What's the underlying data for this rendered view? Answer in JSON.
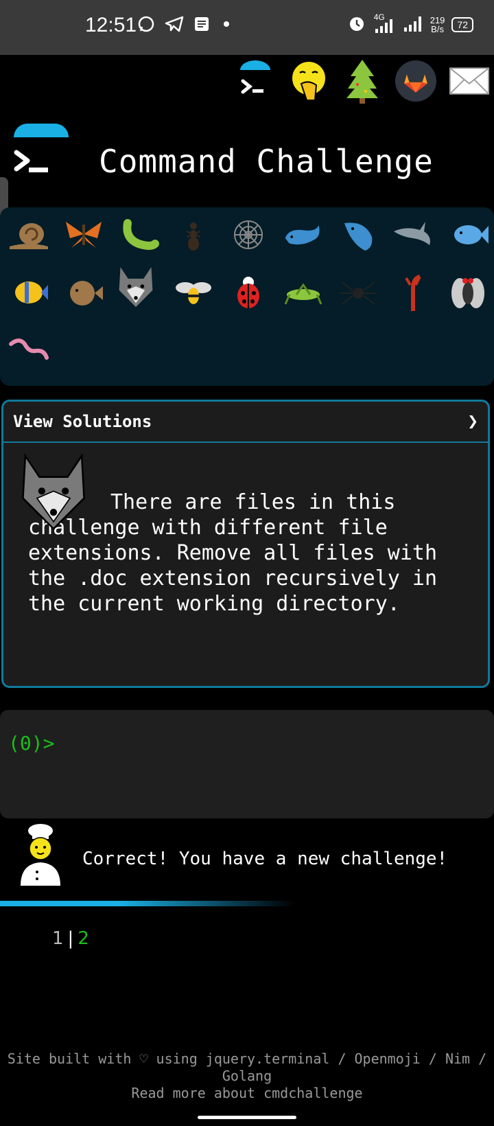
{
  "status_bar": {
    "time": "12:51",
    "network": "4G",
    "speed_value": "219",
    "speed_unit": "B/s",
    "battery": "72"
  },
  "header": {
    "title": "Command Challenge"
  },
  "top_icons": [
    "terminal-icon",
    "face-with-hand-over-mouth-icon",
    "tree-icon",
    "gitlab-icon",
    "mail-icon"
  ],
  "emoji_grid": [
    "snail",
    "butterfly",
    "bug",
    "ant",
    "spider-web",
    "whale",
    "spouting-whale",
    "dolphin",
    "fish",
    "tropical-fish",
    "blowfish",
    "wolf",
    "bee",
    "ladybug",
    "cricket",
    "spider",
    "scorpion",
    "fly",
    "worm"
  ],
  "solutions": {
    "header_label": "View Solutions",
    "arrow": "❯",
    "challenge_text": "There are files in this challenge with different file extensions. Remove all files with the .doc extension recursively in the current working directory."
  },
  "terminal": {
    "prompt": "(0)>"
  },
  "message": {
    "text": "Correct! You have a new challenge!"
  },
  "pagination": {
    "page1": "1",
    "separator": "|",
    "page2": "2"
  },
  "progress": {
    "fraction": 0.6
  },
  "footer": {
    "line1": "Site built with ♡ using jquery.terminal / Openmoji / Nim / Golang",
    "line2": "Read more about cmdchallenge"
  }
}
